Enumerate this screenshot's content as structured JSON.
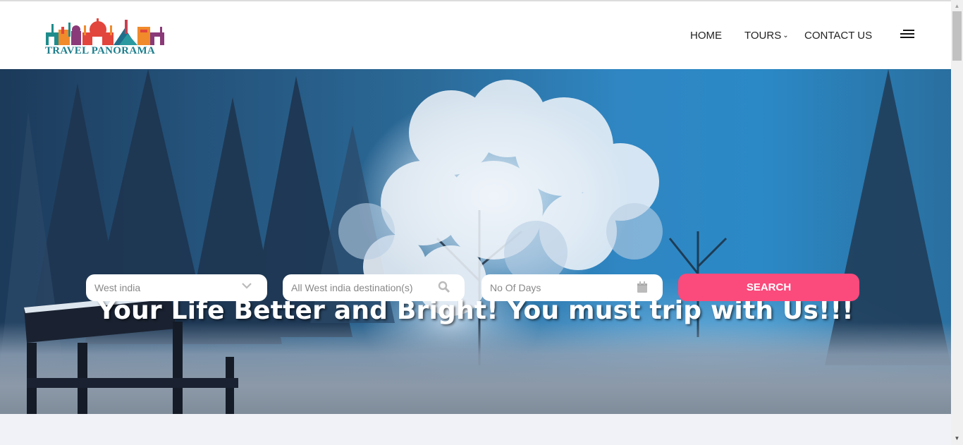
{
  "brand": {
    "name": "TRAVEL PANORAMA",
    "colors": {
      "teal": "#1e7e8c",
      "orange": "#f08a2b",
      "red": "#e2453c",
      "purple": "#8a3a78"
    }
  },
  "nav": {
    "items": [
      {
        "label": "HOME"
      },
      {
        "label": "TOURS",
        "has_dropdown": true
      },
      {
        "label": "CONTACT US"
      }
    ],
    "menu_icon": "hamburger-icon"
  },
  "hero": {
    "title": "Your Life Better and Bright! You must trip with Us!!!"
  },
  "search": {
    "region": {
      "value": "West india",
      "icon": "chevron-down-icon"
    },
    "destination": {
      "placeholder": "All West india destination(s)",
      "icon": "search-icon"
    },
    "days": {
      "placeholder": "No Of Days",
      "icon": "calendar-icon"
    },
    "button_label": "SEARCH",
    "accent_color": "#fb4a7c"
  },
  "scrollbar": {
    "up_arrow": "▲",
    "down_arrow": "▼"
  }
}
